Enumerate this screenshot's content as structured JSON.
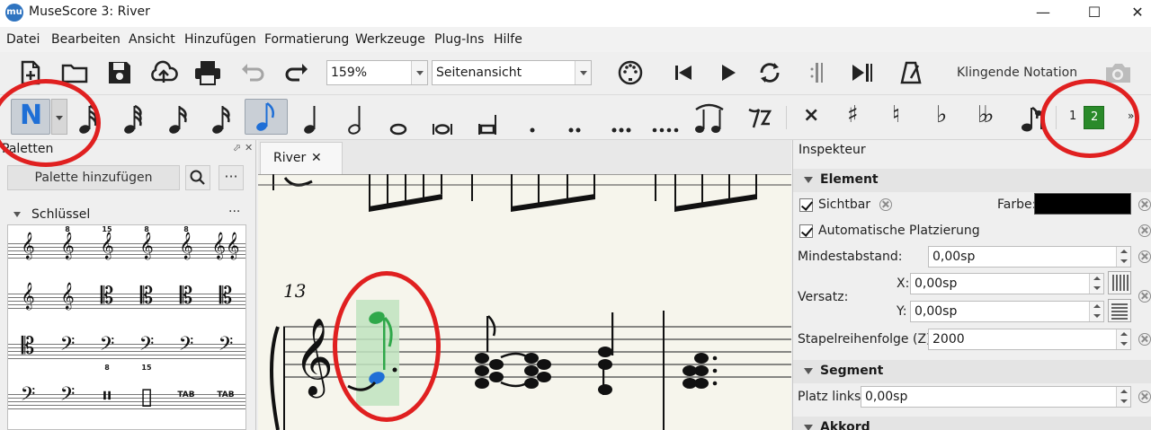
{
  "window": {
    "app_icon_text": "mu",
    "title": "MuseScore 3: River",
    "minimize_symbol": "—",
    "maximize_symbol": "☐",
    "close_symbol": "✕"
  },
  "menu": [
    "Datei",
    "Bearbeiten",
    "Ansicht",
    "Hinzufügen",
    "Formatierung",
    "Werkzeuge",
    "Plug-Ins",
    "Hilfe"
  ],
  "toolbar": {
    "zoom_value": "159%",
    "view_mode": "Seitenansicht",
    "concert_pitch_label": "Klingende Notation",
    "icons": [
      "new-file",
      "open-folder",
      "save",
      "cloud-upload",
      "print",
      "undo",
      "redo",
      "midi-input",
      "rewind",
      "play",
      "loop",
      "metronome",
      "screenshot-camera"
    ]
  },
  "note_input": {
    "mode_glyph": "N",
    "accidentals": [
      "×",
      "♯",
      "♮",
      "♭",
      "♭♭"
    ],
    "voice_1": "1",
    "voice_2": "2",
    "active_voice": "2",
    "more_symbol": "»",
    "selected_duration": "eighth"
  },
  "palettes": {
    "title": "Paletten",
    "add_button": "Palette hinzufügen",
    "search_icon": "search-icon",
    "more_symbol": "···",
    "section_title": "Schlüssel",
    "section_more": "···",
    "clefs": [
      {
        "sym": "𝄞",
        "mark": ""
      },
      {
        "sym": "𝄞",
        "mark": "8"
      },
      {
        "sym": "𝄞",
        "mark": "15"
      },
      {
        "sym": "𝄞",
        "mark": "8"
      },
      {
        "sym": "𝄞",
        "mark": "8"
      },
      {
        "sym": "𝄞𝄞",
        "mark": ""
      },
      {
        "sym": "𝄞",
        "mark": ""
      },
      {
        "sym": "𝄞",
        "mark": ""
      },
      {
        "sym": "𝄡",
        "mark": ""
      },
      {
        "sym": "𝄡",
        "mark": ""
      },
      {
        "sym": "𝄡",
        "mark": ""
      },
      {
        "sym": "𝄡",
        "mark": ""
      },
      {
        "sym": "𝄡",
        "mark": ""
      },
      {
        "sym": "𝄢",
        "mark": ""
      },
      {
        "sym": "𝄢",
        "mark": "8"
      },
      {
        "sym": "𝄢",
        "mark": "15"
      },
      {
        "sym": "𝄢",
        "mark": ""
      },
      {
        "sym": "𝄢",
        "mark": ""
      },
      {
        "sym": "𝄢",
        "mark": ""
      },
      {
        "sym": "𝄢",
        "mark": ""
      },
      {
        "sym": "𝄥",
        "mark": ""
      },
      {
        "sym": "▯",
        "mark": ""
      },
      {
        "sym": "TAB",
        "mark": ""
      },
      {
        "sym": "TAB",
        "mark": ""
      }
    ]
  },
  "score": {
    "tab_label": "River",
    "tab_close": "✕",
    "measure_number": "13"
  },
  "inspector": {
    "title": "Inspekteur",
    "section_element": "Element",
    "visible_label": "Sichtbar",
    "color_label": "Farbe:",
    "color_value": "#000000",
    "auto_place_label": "Automatische Platzierung",
    "min_distance_label": "Mindestabstand:",
    "min_distance_value": "0,00sp",
    "offset_label": "Versatz:",
    "offset_x_label": "X:",
    "offset_x_value": "0,00sp",
    "offset_y_label": "Y:",
    "offset_y_value": "0,00sp",
    "stacking_label": "Stapelreihenfolge (Z):",
    "stacking_value": "2000",
    "section_segment": "Segment",
    "leading_space_label": "Platz links:",
    "leading_space_value": "0,00sp",
    "section_chord": "Akkord"
  },
  "colors": {
    "note_input_blue": "#1f6fd6",
    "selection_green": "#2fa84a",
    "voice2_bg": "#2a8a2a",
    "annotation_red": "#e02020",
    "score_paper": "#f6f5ec"
  }
}
